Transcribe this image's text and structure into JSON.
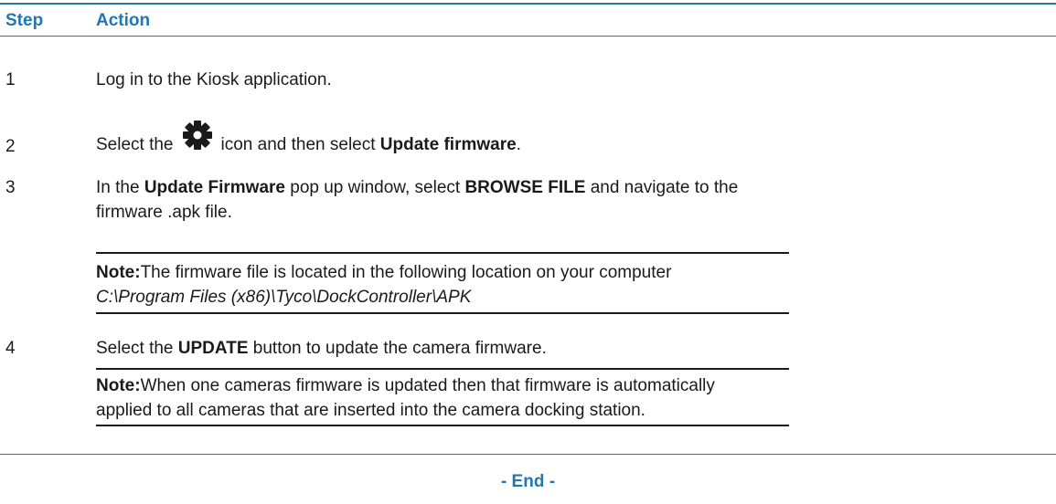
{
  "header": {
    "step_label": "Step",
    "action_label": "Action"
  },
  "steps": [
    {
      "num": "1",
      "text": "Log in to the Kiosk application."
    },
    {
      "num": "2",
      "pre": "Select the",
      "icon": "gear-icon",
      "mid": "icon and then select",
      "bold": "Update firmware",
      "post": "."
    },
    {
      "num": "3",
      "line1_pre": "In the",
      "line1_bold1": "Update Firmware",
      "line1_mid": "pop up window, select",
      "line1_bold2": "BROWSE FILE",
      "line1_post": "and navigate to the",
      "line2": "firmware .apk file.",
      "note_label": "Note:",
      "note_text": "The firmware file is located in the following location on your computer",
      "note_path": "C:\\Program Files (x86)\\Tyco\\DockController\\APK"
    },
    {
      "num": "4",
      "pre": "Select the",
      "bold": "UPDATE",
      "post": "button to update the camera firmware.",
      "note_label": "Note:",
      "note_line1": "When one cameras firmware is updated then that firmware is automatically",
      "note_line2": "applied to all cameras that are inserted into the camera docking station."
    }
  ],
  "footer": {
    "end_label": "- End -"
  },
  "colors": {
    "accent": "#1f77b4",
    "text": "#1a1a1a"
  }
}
